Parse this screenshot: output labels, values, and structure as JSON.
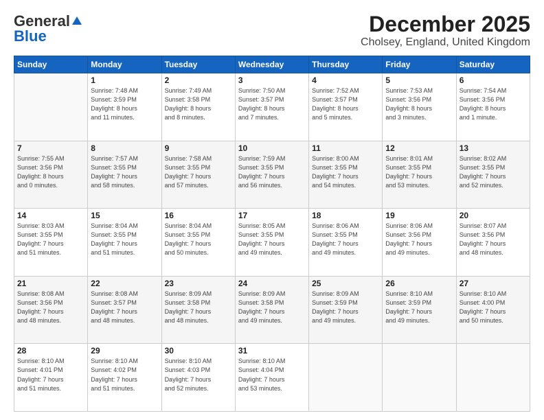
{
  "logo": {
    "general": "General",
    "blue": "Blue"
  },
  "title": "December 2025",
  "location": "Cholsey, England, United Kingdom",
  "days_header": [
    "Sunday",
    "Monday",
    "Tuesday",
    "Wednesday",
    "Thursday",
    "Friday",
    "Saturday"
  ],
  "weeks": [
    [
      {
        "day": "",
        "info": ""
      },
      {
        "day": "1",
        "info": "Sunrise: 7:48 AM\nSunset: 3:59 PM\nDaylight: 8 hours\nand 11 minutes."
      },
      {
        "day": "2",
        "info": "Sunrise: 7:49 AM\nSunset: 3:58 PM\nDaylight: 8 hours\nand 8 minutes."
      },
      {
        "day": "3",
        "info": "Sunrise: 7:50 AM\nSunset: 3:57 PM\nDaylight: 8 hours\nand 7 minutes."
      },
      {
        "day": "4",
        "info": "Sunrise: 7:52 AM\nSunset: 3:57 PM\nDaylight: 8 hours\nand 5 minutes."
      },
      {
        "day": "5",
        "info": "Sunrise: 7:53 AM\nSunset: 3:56 PM\nDaylight: 8 hours\nand 3 minutes."
      },
      {
        "day": "6",
        "info": "Sunrise: 7:54 AM\nSunset: 3:56 PM\nDaylight: 8 hours\nand 1 minute."
      }
    ],
    [
      {
        "day": "7",
        "info": "Sunrise: 7:55 AM\nSunset: 3:56 PM\nDaylight: 8 hours\nand 0 minutes."
      },
      {
        "day": "8",
        "info": "Sunrise: 7:57 AM\nSunset: 3:55 PM\nDaylight: 7 hours\nand 58 minutes."
      },
      {
        "day": "9",
        "info": "Sunrise: 7:58 AM\nSunset: 3:55 PM\nDaylight: 7 hours\nand 57 minutes."
      },
      {
        "day": "10",
        "info": "Sunrise: 7:59 AM\nSunset: 3:55 PM\nDaylight: 7 hours\nand 56 minutes."
      },
      {
        "day": "11",
        "info": "Sunrise: 8:00 AM\nSunset: 3:55 PM\nDaylight: 7 hours\nand 54 minutes."
      },
      {
        "day": "12",
        "info": "Sunrise: 8:01 AM\nSunset: 3:55 PM\nDaylight: 7 hours\nand 53 minutes."
      },
      {
        "day": "13",
        "info": "Sunrise: 8:02 AM\nSunset: 3:55 PM\nDaylight: 7 hours\nand 52 minutes."
      }
    ],
    [
      {
        "day": "14",
        "info": "Sunrise: 8:03 AM\nSunset: 3:55 PM\nDaylight: 7 hours\nand 51 minutes."
      },
      {
        "day": "15",
        "info": "Sunrise: 8:04 AM\nSunset: 3:55 PM\nDaylight: 7 hours\nand 51 minutes."
      },
      {
        "day": "16",
        "info": "Sunrise: 8:04 AM\nSunset: 3:55 PM\nDaylight: 7 hours\nand 50 minutes."
      },
      {
        "day": "17",
        "info": "Sunrise: 8:05 AM\nSunset: 3:55 PM\nDaylight: 7 hours\nand 49 minutes."
      },
      {
        "day": "18",
        "info": "Sunrise: 8:06 AM\nSunset: 3:55 PM\nDaylight: 7 hours\nand 49 minutes."
      },
      {
        "day": "19",
        "info": "Sunrise: 8:06 AM\nSunset: 3:56 PM\nDaylight: 7 hours\nand 49 minutes."
      },
      {
        "day": "20",
        "info": "Sunrise: 8:07 AM\nSunset: 3:56 PM\nDaylight: 7 hours\nand 48 minutes."
      }
    ],
    [
      {
        "day": "21",
        "info": "Sunrise: 8:08 AM\nSunset: 3:56 PM\nDaylight: 7 hours\nand 48 minutes."
      },
      {
        "day": "22",
        "info": "Sunrise: 8:08 AM\nSunset: 3:57 PM\nDaylight: 7 hours\nand 48 minutes."
      },
      {
        "day": "23",
        "info": "Sunrise: 8:09 AM\nSunset: 3:58 PM\nDaylight: 7 hours\nand 48 minutes."
      },
      {
        "day": "24",
        "info": "Sunrise: 8:09 AM\nSunset: 3:58 PM\nDaylight: 7 hours\nand 49 minutes."
      },
      {
        "day": "25",
        "info": "Sunrise: 8:09 AM\nSunset: 3:59 PM\nDaylight: 7 hours\nand 49 minutes."
      },
      {
        "day": "26",
        "info": "Sunrise: 8:10 AM\nSunset: 3:59 PM\nDaylight: 7 hours\nand 49 minutes."
      },
      {
        "day": "27",
        "info": "Sunrise: 8:10 AM\nSunset: 4:00 PM\nDaylight: 7 hours\nand 50 minutes."
      }
    ],
    [
      {
        "day": "28",
        "info": "Sunrise: 8:10 AM\nSunset: 4:01 PM\nDaylight: 7 hours\nand 51 minutes."
      },
      {
        "day": "29",
        "info": "Sunrise: 8:10 AM\nSunset: 4:02 PM\nDaylight: 7 hours\nand 51 minutes."
      },
      {
        "day": "30",
        "info": "Sunrise: 8:10 AM\nSunset: 4:03 PM\nDaylight: 7 hours\nand 52 minutes."
      },
      {
        "day": "31",
        "info": "Sunrise: 8:10 AM\nSunset: 4:04 PM\nDaylight: 7 hours\nand 53 minutes."
      },
      {
        "day": "",
        "info": ""
      },
      {
        "day": "",
        "info": ""
      },
      {
        "day": "",
        "info": ""
      }
    ]
  ]
}
